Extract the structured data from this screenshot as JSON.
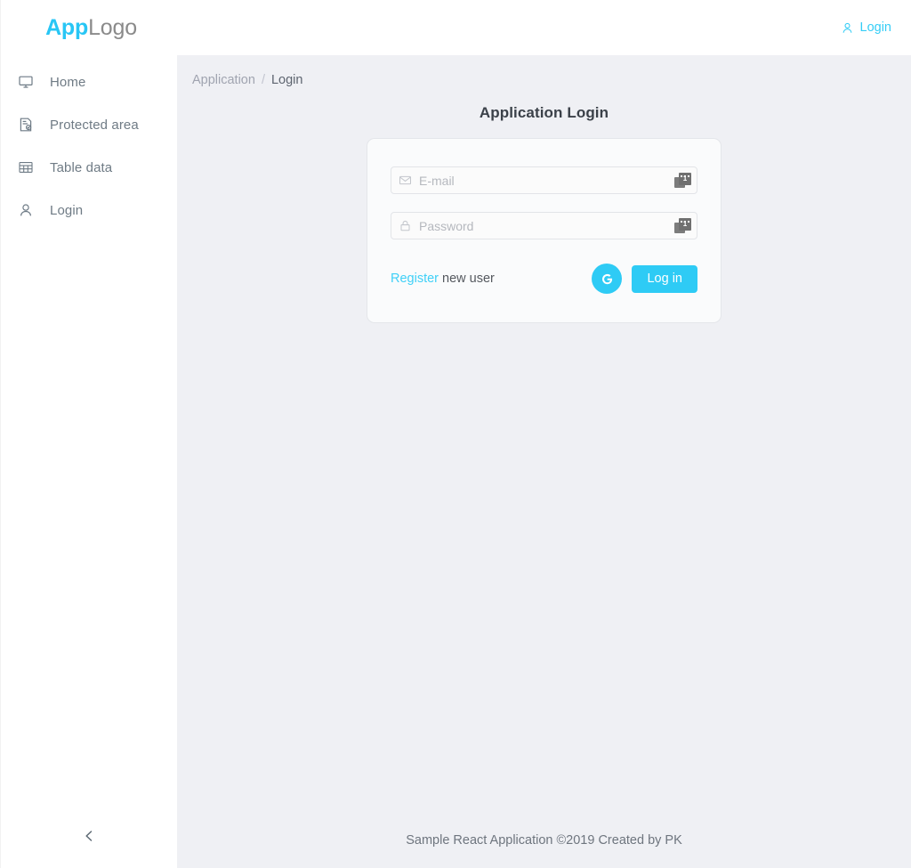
{
  "brand": {
    "strong": "App",
    "rest": "Logo",
    "accent": "#28c6f5"
  },
  "sidebar": {
    "items": [
      {
        "label": "Home",
        "icon": "monitor-icon"
      },
      {
        "label": "Protected area",
        "icon": "protected-document-icon"
      },
      {
        "label": "Table data",
        "icon": "table-grid-icon"
      },
      {
        "label": "Login",
        "icon": "user-icon"
      }
    ],
    "collapse_icon": "chevron-left-icon"
  },
  "topbar": {
    "login_label": "Login",
    "login_icon": "user-icon",
    "login_color": "#35cdf6"
  },
  "breadcrumb": {
    "root": "Application",
    "separator": "/",
    "current": "Login"
  },
  "page": {
    "title": "Application Login"
  },
  "form": {
    "email": {
      "placeholder": "E-mail",
      "value": "",
      "icon": "envelope-icon",
      "badge": "password-manager-badge",
      "badge_count": "1"
    },
    "password": {
      "placeholder": "Password",
      "value": "",
      "icon": "lock-icon",
      "badge": "password-manager-badge",
      "badge_count": "1"
    },
    "register_link": "Register",
    "register_rest": " new user",
    "google_label": "G",
    "submit_label": "Log in",
    "accent": "#2ecbf5"
  },
  "footer": {
    "text": "Sample React Application ©2019 Created by PK"
  }
}
